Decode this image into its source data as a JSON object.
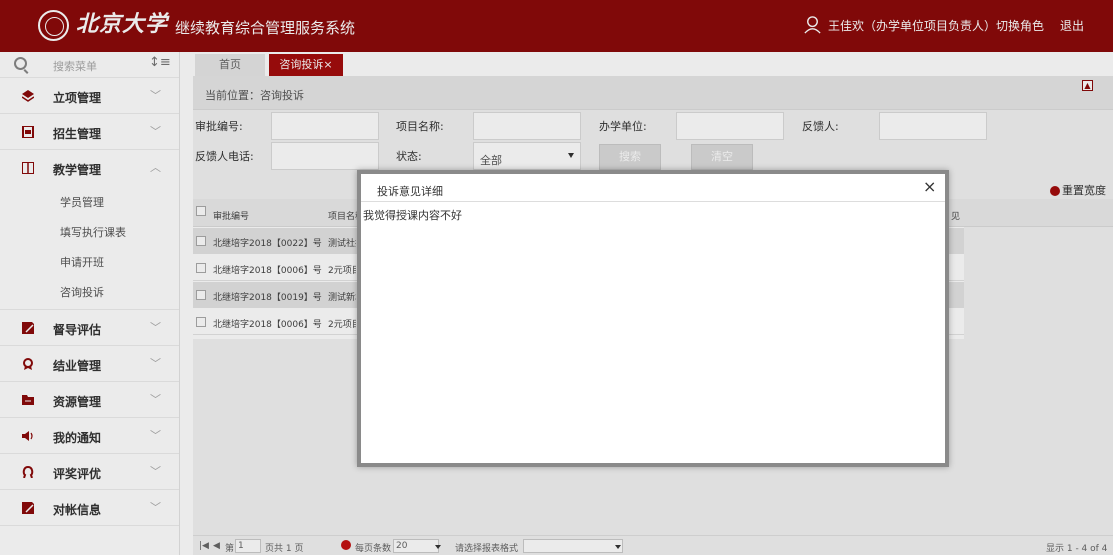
{
  "header": {
    "logo_text": "北京大学",
    "system_title": "继续教育综合管理服务系统",
    "user": "王佳欢（办学单位项目负责人）",
    "switch_role": "切换角色",
    "logout": "退出"
  },
  "sidebar": {
    "search_placeholder": "搜索菜单",
    "sort_icon": "↕≡",
    "items": [
      {
        "label": "立项管理",
        "icon": "layers-icon"
      },
      {
        "label": "招生管理",
        "icon": "document-icon"
      },
      {
        "label": "教学管理",
        "icon": "book-icon",
        "expanded": true
      },
      {
        "label": "督导评估",
        "icon": "edit-icon"
      },
      {
        "label": "结业管理",
        "icon": "award-icon"
      },
      {
        "label": "资源管理",
        "icon": "folder-icon"
      },
      {
        "label": "我的通知",
        "icon": "speaker-icon"
      },
      {
        "label": "评奖评优",
        "icon": "ribbon-icon"
      },
      {
        "label": "对帐信息",
        "icon": "pencil-icon"
      }
    ],
    "sub_items": [
      "学员管理",
      "填写执行课表",
      "申请开班",
      "咨询投诉"
    ]
  },
  "tabs": {
    "home": "首页",
    "active": "咨询投诉×"
  },
  "breadcrumb": "当前位置：咨询投诉",
  "filters": {
    "approval_no": "审批编号:",
    "project_name": "项目名称:",
    "school_unit": "办学单位:",
    "feedback_person": "反馈人:",
    "feedback_phone": "反馈人电话:",
    "status": "状态:",
    "status_value": "全部",
    "search_btn": "搜索",
    "clear_btn": "清空"
  },
  "reset_width": "重置宽度",
  "grid": {
    "columns": [
      "审批编号",
      "项目名称"
    ],
    "right_header": "见",
    "rows": [
      {
        "approval": "北继培字2018【0022】号",
        "project": "测试社招"
      },
      {
        "approval": "北继培字2018【0006】号",
        "project": "2元项目"
      },
      {
        "approval": "北继培字2018【0019】号",
        "project": "测试新增"
      },
      {
        "approval": "北继培字2018【0006】号",
        "project": "2元项目"
      }
    ]
  },
  "pager": {
    "page_label": "第",
    "page_value": "1",
    "page_total": "页共 1 页",
    "per_page_label": "每页条数",
    "per_page_value": "20",
    "format_label": "请选择报表格式",
    "display": "显示 1 - 4 of 4"
  },
  "modal": {
    "title": "投诉意见详细",
    "content": "我觉得授课内容不好"
  },
  "colors": {
    "brand": "#8b0a0a",
    "accent": "#a30d0d"
  }
}
